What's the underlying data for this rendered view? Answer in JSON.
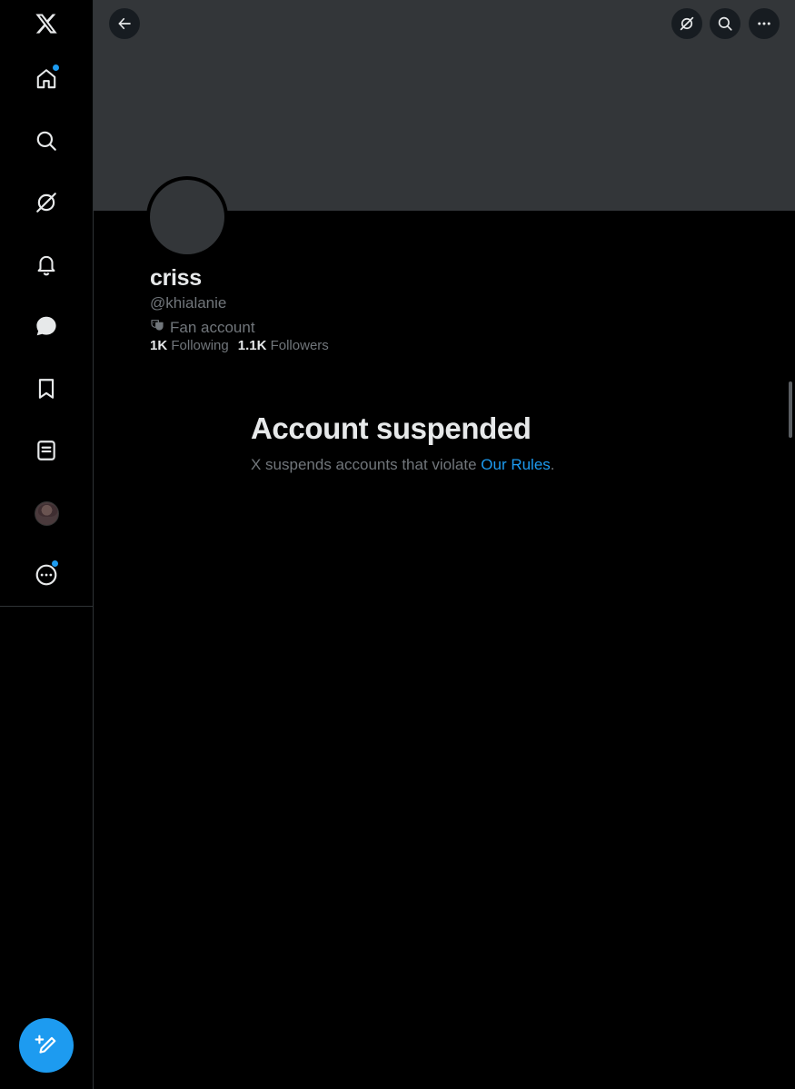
{
  "sidebar": {
    "items": [
      {
        "name": "x-logo",
        "icon": "x-logo-icon"
      },
      {
        "name": "home",
        "icon": "home-icon",
        "notification_dot": true
      },
      {
        "name": "explore",
        "icon": "search-icon"
      },
      {
        "name": "grok",
        "icon": "grok-icon"
      },
      {
        "name": "notifications",
        "icon": "bell-icon"
      },
      {
        "name": "messages",
        "icon": "message-icon"
      },
      {
        "name": "bookmarks",
        "icon": "bookmark-icon"
      },
      {
        "name": "lists",
        "icon": "list-icon"
      },
      {
        "name": "profile",
        "icon": "avatar"
      },
      {
        "name": "more",
        "icon": "more-circle-icon",
        "notification_dot": true
      }
    ],
    "compose_icon": "compose-icon"
  },
  "header": {
    "back_icon": "back-arrow-icon",
    "grok_icon": "grok-icon",
    "search_icon": "search-icon",
    "more_icon": "more-horizontal-icon"
  },
  "profile": {
    "display_name": "criss",
    "handle": "@khialanie",
    "category": "Fan account",
    "category_icon": "theater-masks-icon",
    "following_count": "1K",
    "following_label": "Following",
    "followers_count": "1.1K",
    "followers_label": "Followers"
  },
  "suspended": {
    "title": "Account suspended",
    "text": "X suspends accounts that violate ",
    "link": "Our Rules",
    "suffix": "."
  },
  "colors": {
    "accent": "#1d9bf0",
    "banner": "#333639",
    "muted_text": "#71767b",
    "primary_text": "#e7e9ea"
  }
}
